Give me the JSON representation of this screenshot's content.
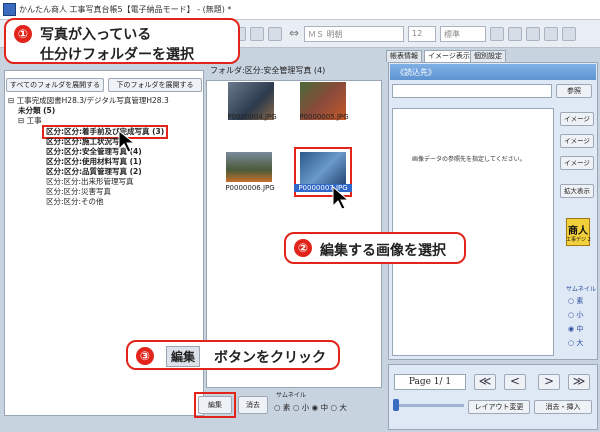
{
  "title_bar": {
    "app_name": "かんたん商人 工事写真台帳5【電子納品モード】 - (無題) *"
  },
  "toolbar": {
    "font_name": "ＭＳ 明朝",
    "font_size": "12",
    "font_style": "標準"
  },
  "left_panel": {
    "expand_all_label": "すべてのフォルダを展開する",
    "expand_below_label": "下のフォルダを展開する",
    "tree": [
      {
        "label": "工事完成図書H28.3/デジタル写真管理H28.3",
        "indent": 0,
        "bold": false
      },
      {
        "label": "未分類 (5)",
        "indent": 1,
        "bold": true
      },
      {
        "label": "工事",
        "indent": 1,
        "bold": false
      },
      {
        "label": "区分:区分:着手前及び完成写真 (3)",
        "indent": 2,
        "bold": true,
        "selected": true
      },
      {
        "label": "区分:区分:施工状況写真",
        "indent": 2,
        "bold": true
      },
      {
        "label": "区分:区分:安全管理写真 (4)",
        "indent": 2,
        "bold": true
      },
      {
        "label": "区分:区分:使用材料写真 (1)",
        "indent": 2,
        "bold": true
      },
      {
        "label": "区分:区分:品質管理写真 (2)",
        "indent": 2,
        "bold": true
      },
      {
        "label": "区分:区分:出来形管理写真",
        "indent": 2,
        "bold": false
      },
      {
        "label": "区分:区分:災害写真",
        "indent": 2,
        "bold": false
      },
      {
        "label": "区分:区分:その他",
        "indent": 2,
        "bold": false
      }
    ]
  },
  "middle_panel": {
    "folder_header": "フォルダ:区分:安全管理写真 (4)",
    "thumbnails": [
      {
        "caption": "P0000004.JPG"
      },
      {
        "caption": "P0000005.JPG"
      },
      {
        "caption": "P0000006.JPG"
      },
      {
        "caption": "P0000007.JPG",
        "selected": true
      }
    ],
    "edit_label": "編集",
    "erase_label": "消去",
    "thumb_size_label": "サムネイル",
    "thumb_sizes": [
      "○ 素",
      "○ 小",
      "◉ 中",
      "○ 大"
    ]
  },
  "right_panel": {
    "tabs": [
      "帳表情報",
      "イメージ表示",
      "個別設定"
    ],
    "header": "《読込先》",
    "browse_label": "参照",
    "preview_message": "画像データの参照先を指定してください。",
    "image_buttons": [
      "イメージ",
      "イメージ",
      "イメージ"
    ],
    "enlarge_label": "拡大表示",
    "logo_text": "商人",
    "logo_sub": "工事デジ 2",
    "size_label": "サムネイル",
    "sizes": [
      "○ 素",
      "○ 小",
      "◉ 中",
      "○ 大"
    ]
  },
  "pager": {
    "page_text": "Page 1/ 1",
    "first": "≪",
    "prev": "<",
    "next": ">",
    "last": "≫",
    "layout_change_label": "レイアウト変更",
    "erase_insert_label": "消去・挿入"
  },
  "callouts": [
    {
      "number": "①",
      "line1": "写真が入っている",
      "line2": "仕分けフォルダーを選択"
    },
    {
      "number": "②",
      "text": "編集する画像を選択"
    },
    {
      "number": "③",
      "button": "編集",
      "text": "ボタンをクリック"
    }
  ],
  "colors": {
    "accent": "#e2241b",
    "header_blue": "#5e93d1",
    "selection_blue": "#2f68c8"
  }
}
